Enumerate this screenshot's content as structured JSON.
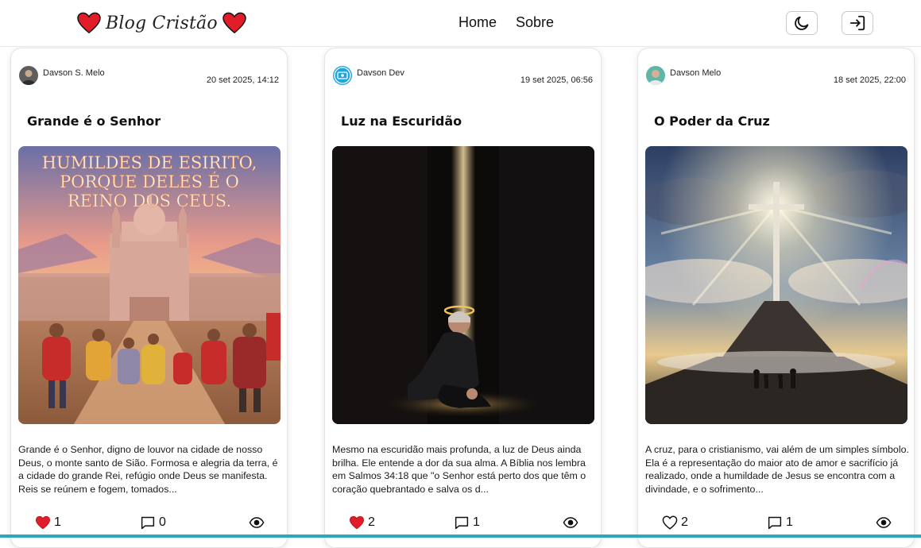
{
  "header": {
    "brand": "Blog Cristão",
    "nav": [
      {
        "label": "Home"
      },
      {
        "label": "Sobre"
      }
    ],
    "theme_icon": "moon-icon",
    "login_icon": "login-icon"
  },
  "colors": {
    "heart_red": "#e11d2a",
    "accent_teal": "#2aa9b8"
  },
  "posts": [
    {
      "author": "Davson S. Melo",
      "date": "20 set 2025, 14:12",
      "title": "Grande é o Senhor",
      "image_caption": "HUMILDES DE ESIRITO, PORQUE DELES É O REINO DOS CEUS.",
      "excerpt": "Grande é o Senhor, digno de louvor na cidade de nosso Deus, o monte santo de Sião. Formosa e alegria da terra, é a cidade do grande Rei, refúgio onde Deus se manifesta. Reis se reúnem e fogem, tomados...",
      "likes": "1",
      "liked": true,
      "comments": "0"
    },
    {
      "author": "Davson Dev",
      "date": "19 set 2025, 06:56",
      "title": "Luz na Escuridão",
      "excerpt": "Mesmo na escuridão mais profunda, a luz de Deus ainda brilha. Ele entende a dor da sua alma. A Bíblia nos lembra em Salmos 34:18 que \"o Senhor está perto dos que têm o coração quebrantado e salva os d...",
      "likes": "2",
      "liked": true,
      "comments": "1"
    },
    {
      "author": "Davson Melo",
      "date": "18 set 2025, 22:00",
      "title": "O Poder da Cruz",
      "excerpt": "A cruz, para o cristianismo, vai além de um simples símbolo. Ela é a representação do maior ato de amor e sacrifício já realizado, onde a humildade de Jesus se encontra com a divindade, e o sofrimento...",
      "likes": "2",
      "liked": false,
      "comments": "1"
    }
  ]
}
